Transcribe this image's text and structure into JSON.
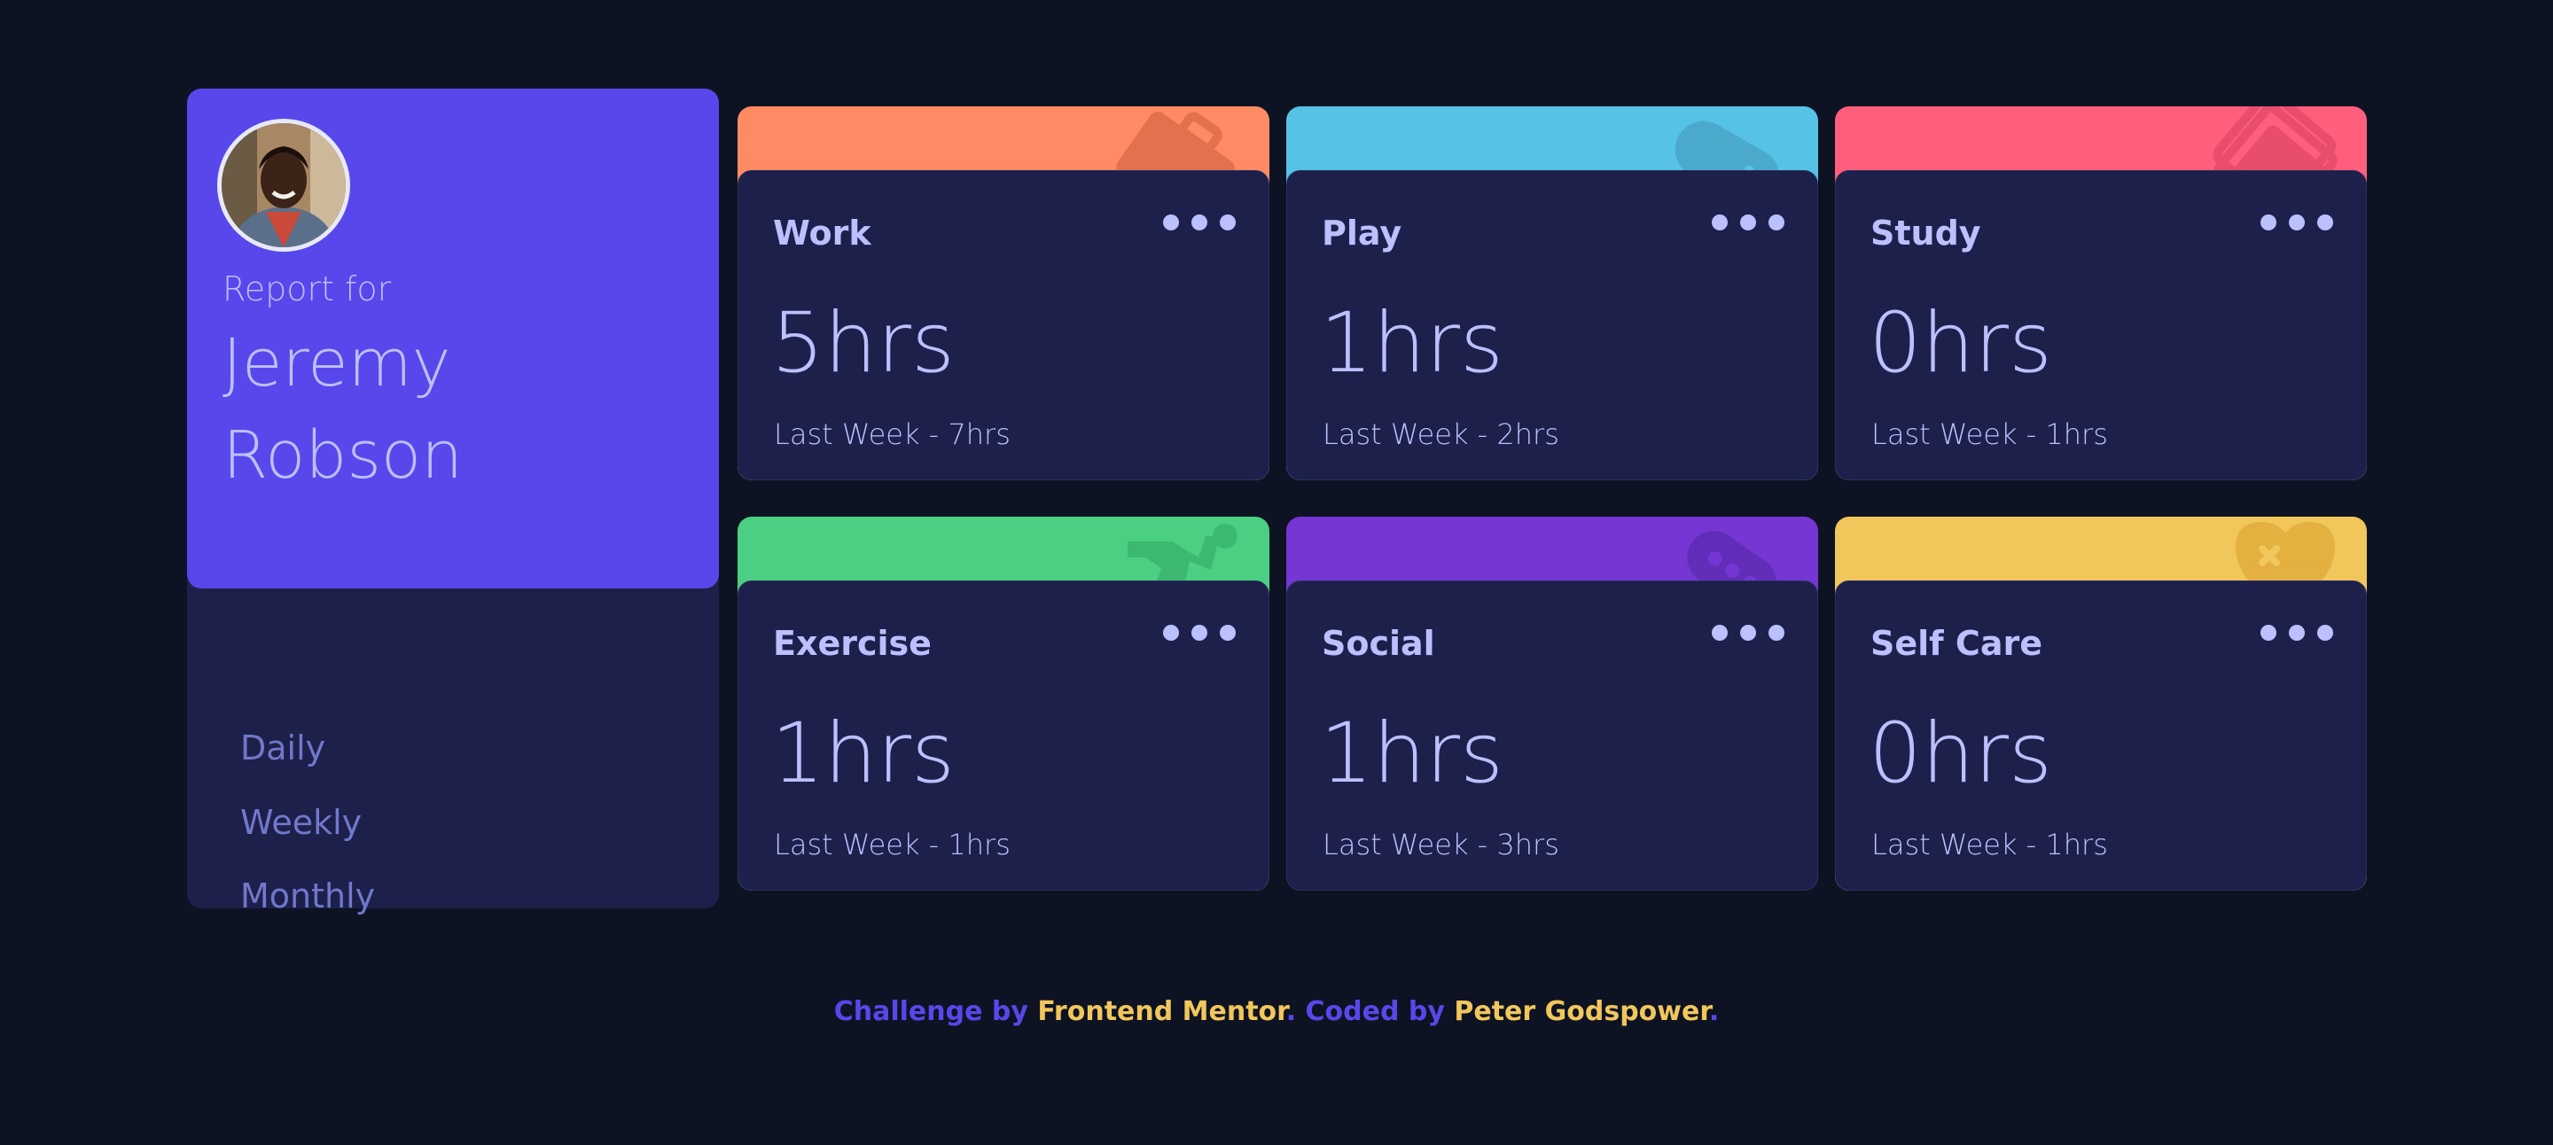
{
  "profile": {
    "report_label": "Report for",
    "name": "Jeremy Robson",
    "avatar_alt": "image-jeremy"
  },
  "timeframes": [
    "Daily",
    "Weekly",
    "Monthly"
  ],
  "activities": [
    {
      "title": "Work",
      "current": "5hrs",
      "previous": "Last Week - 7hrs",
      "color": "#ff8b64",
      "icon": "briefcase-icon"
    },
    {
      "title": "Play",
      "current": "1hrs",
      "previous": "Last Week - 2hrs",
      "color": "#55c2e6",
      "icon": "gamepad-icon"
    },
    {
      "title": "Study",
      "current": "0hrs",
      "previous": "Last Week - 1hrs",
      "color": "#ff5e7d",
      "icon": "book-icon"
    },
    {
      "title": "Exercise",
      "current": "1hrs",
      "previous": "Last Week - 1hrs",
      "color": "#4bcf82",
      "icon": "running-icon"
    },
    {
      "title": "Social",
      "current": "1hrs",
      "previous": "Last Week - 3hrs",
      "color": "#7536d3",
      "icon": "chat-icon"
    },
    {
      "title": "Self Care",
      "current": "0hrs",
      "previous": "Last Week - 1hrs",
      "color": "#f1c65b",
      "icon": "heart-icon"
    }
  ],
  "footer": {
    "prefix": "Challenge by ",
    "author1": "Frontend Mentor",
    "middle": ". Coded by ",
    "author2": "Peter Godspower",
    "suffix": "."
  },
  "colors": {
    "background": "#0e1323",
    "card": "#1c204b",
    "accent": "#5847eb",
    "text": "#bbc0ff",
    "muted": "#7078c9",
    "highlight": "#f1c65b"
  }
}
